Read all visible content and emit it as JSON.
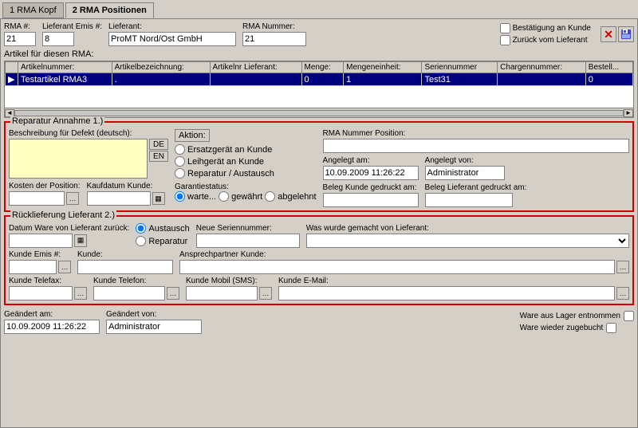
{
  "tabs": [
    {
      "id": "kopf",
      "label": "1 RMA Kopf",
      "active": false
    },
    {
      "id": "positionen",
      "label": "2 RMA Positionen",
      "active": true
    }
  ],
  "header": {
    "rma_nr_label": "RMA #:",
    "rma_nr_value": "21",
    "lieferant_emis_label": "Lieferant Emis #:",
    "lieferant_emis_value": "8",
    "lieferant_label": "Lieferant:",
    "lieferant_value": "ProMT Nord/Ost GmbH",
    "rma_nummer_label": "RMA Nummer:",
    "rma_nummer_value": "21",
    "checkbox_bestaetigung": "Bestätigung an Kunde",
    "checkbox_zurueck": "Zurück vom Lieferant"
  },
  "artikel_label": "Artikel für diesen RMA:",
  "table": {
    "columns": [
      "Artikelnummer:",
      "Artikelbezeichnung:",
      "Artikelnr Lieferant:",
      "Menge:",
      "Mengeneinheit:",
      "Seriennummer",
      "Chargennummer:",
      "Bestell..."
    ],
    "rows": [
      {
        "selected": true,
        "arrow": "▶",
        "artikelnummer": "Testartikel RMA3",
        "artikelbezeichnung": ".",
        "artikelnr_lieferant": "",
        "menge": "0",
        "mengeneinheit": "1",
        "seriennummer": "Test31",
        "chargennummer": "",
        "bestellung": "0"
      }
    ]
  },
  "section1": {
    "title": "Reparatur Annahme 1.)",
    "defect_label": "Beschreibung für Defekt (deutsch):",
    "defect_value": "",
    "btn_de": "DE",
    "btn_en": "EN",
    "kosten_label": "Kosten der Position:",
    "kosten_value": "",
    "kaufdatum_label": "Kaufdatum Kunde:",
    "kaufdatum_value": "",
    "aktion_label": "Aktion:",
    "aktion_options": [
      {
        "id": "ersatz",
        "label": "Ersatzgerät an Kunde"
      },
      {
        "id": "leih",
        "label": "Leihgerät an Kunde"
      },
      {
        "id": "reparatur",
        "label": "Reparatur / Austausch"
      }
    ],
    "garantie_label": "Garantiestatus:",
    "garantie_options": [
      {
        "id": "warte",
        "label": "warte..."
      },
      {
        "id": "gewaehrt",
        "label": "gewährt"
      },
      {
        "id": "abgelehnt",
        "label": "abgelehnt"
      }
    ],
    "garantie_selected": "warte",
    "rma_nummer_pos_label": "RMA Nummer Position:",
    "rma_nummer_pos_value": "",
    "angelegt_am_label": "Angelegt am:",
    "angelegt_am_value": "10.09.2009 11:26:22",
    "angelegt_von_label": "Angelegt von:",
    "angelegt_von_value": "Administrator",
    "beleg_kunde_label": "Beleg Kunde gedruckt am:",
    "beleg_kunde_value": "",
    "beleg_lieferant_label": "Beleg Lieferant gedruckt am:",
    "beleg_lieferant_value": ""
  },
  "section2": {
    "title": "Rücklieferung Lieferant 2.)",
    "datum_label": "Datum Ware von Lieferant zurück:",
    "datum_value": "",
    "austausch_label": "Austausch",
    "reparatur_label": "Reparatur",
    "neue_sn_label": "Neue Seriennummer:",
    "neue_sn_value": "",
    "was_gemacht_label": "Was wurde gemacht von Lieferant:",
    "was_gemacht_value": "",
    "kunde_emis_label": "Kunde Emis #:",
    "kunde_emis_value": "",
    "kunde_label": "Kunde:",
    "kunde_value": "",
    "ansprechpartner_label": "Ansprechpartner Kunde:",
    "ansprechpartner_value": "",
    "telefax_label": "Kunde Telefax:",
    "telefax_value": "",
    "telefon_label": "Kunde Telefon:",
    "telefon_value": "",
    "mobil_label": "Kunde Mobil (SMS):",
    "mobil_value": "",
    "email_label": "Kunde E-Mail:",
    "email_value": ""
  },
  "footer": {
    "geaendert_am_label": "Geändert am:",
    "geaendert_am_value": "10.09.2009 11:26:22",
    "geaendert_von_label": "Geändert von:",
    "geaendert_von_value": "Administrator",
    "ware_entnommen_label": "Ware aus Lager entnommen",
    "ware_zugebucht_label": "Ware wieder zugebucht"
  },
  "icons": {
    "close": "✕",
    "save": "💾",
    "scroll_left": "◄",
    "scroll_right": "►",
    "calendar": "▦",
    "browse": "…",
    "dropdown": "▼"
  }
}
